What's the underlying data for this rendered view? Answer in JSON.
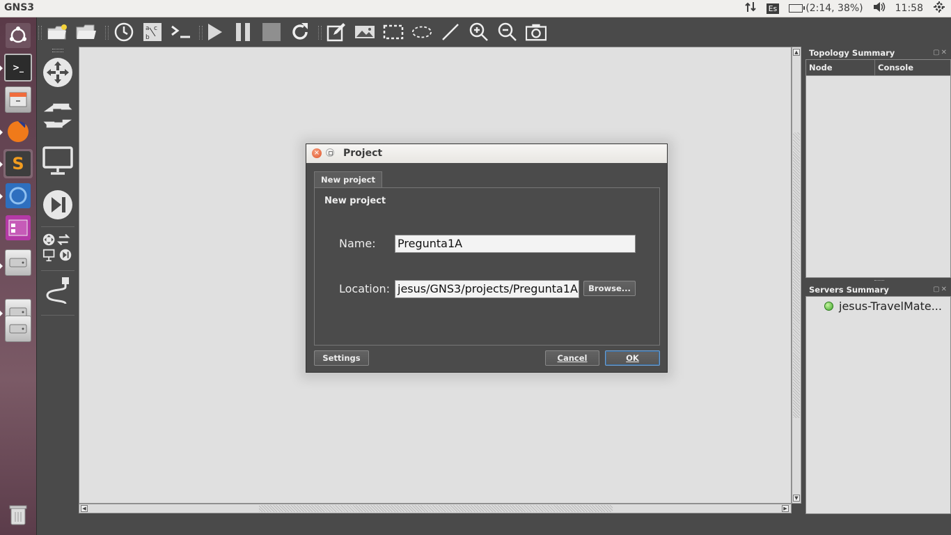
{
  "topbar": {
    "app_title": "GNS3",
    "keyboard_layout": "Es",
    "battery": "(2:14, 38%)",
    "time": "11:58"
  },
  "launcher": {
    "items": [
      "ubuntu-dash",
      "terminal",
      "files",
      "firefox",
      "sublime-text",
      "gns3",
      "software-center",
      "drive-1",
      "drive-2",
      "drive-3",
      "trash"
    ]
  },
  "toolbar": {
    "buttons": [
      "new-project",
      "open-project",
      "snapshot",
      "show-interface-labels",
      "console-all",
      "start-all",
      "suspend-all",
      "stop-all",
      "reload-all",
      "add-note",
      "insert-image",
      "draw-rectangle",
      "draw-ellipse",
      "draw-line",
      "zoom-in",
      "zoom-out",
      "screenshot"
    ]
  },
  "dock": {
    "buttons": [
      "routers",
      "switches",
      "end-devices",
      "security-devices",
      "all-devices",
      "add-link"
    ]
  },
  "topology_summary": {
    "title": "Topology Summary",
    "columns": [
      "Node",
      "Console"
    ]
  },
  "servers_summary": {
    "title": "Servers Summary",
    "servers": [
      {
        "name": "jesus-TravelMate...",
        "status": "running",
        "color": "#3fa52a"
      }
    ]
  },
  "dialog": {
    "title": "Project",
    "tab": "New project",
    "heading": "New project",
    "name_label": "Name:",
    "name_value": "Pregunta1A",
    "location_label": "Location:",
    "location_value": "jesus/GNS3/projects/Pregunta1A",
    "browse_label": "Browse...",
    "settings_label": "Settings",
    "cancel_label": "Cancel",
    "ok_label": "OK"
  }
}
